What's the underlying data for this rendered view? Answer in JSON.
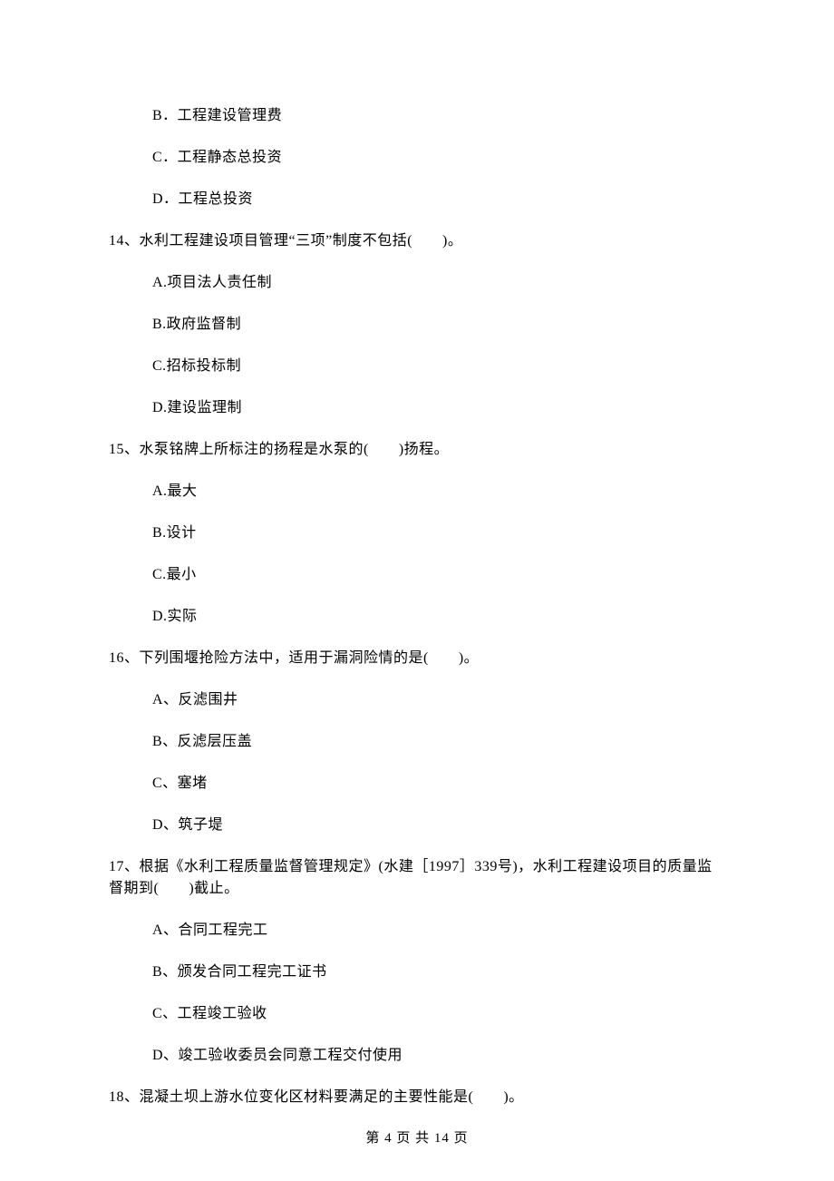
{
  "options_pre": [
    "B．工程建设管理费",
    "C．工程静态总投资",
    "D．工程总投资"
  ],
  "q14": {
    "text": "14、水利工程建设项目管理“三项”制度不包括(　　)。",
    "opts": [
      "A.项目法人责任制",
      "B.政府监督制",
      "C.招标投标制",
      "D.建设监理制"
    ]
  },
  "q15": {
    "text": "15、水泵铭牌上所标注的扬程是水泵的(　　)扬程。",
    "opts": [
      "A.最大",
      "B.设计",
      "C.最小",
      "D.实际"
    ]
  },
  "q16": {
    "text": "16、下列围堰抢险方法中，适用于漏洞险情的是(　　)。",
    "opts": [
      "A、反滤围井",
      "B、反滤层压盖",
      "C、塞堵",
      "D、筑子堤"
    ]
  },
  "q17": {
    "text": "17、根据《水利工程质量监督管理规定》(水建［1997］339号)，水利工程建设项目的质量监督期到(　　)截止。",
    "opts": [
      "A、合同工程完工",
      "B、颁发合同工程完工证书",
      "C、工程竣工验收",
      "D、竣工验收委员会同意工程交付使用"
    ]
  },
  "q18": {
    "text": "18、混凝土坝上游水位变化区材料要满足的主要性能是(　　)。"
  },
  "footer": "第 4 页 共 14 页"
}
